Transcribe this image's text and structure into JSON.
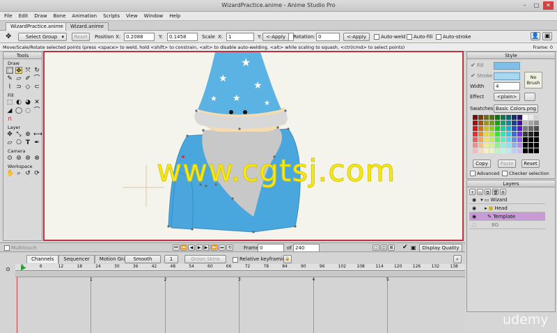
{
  "window": {
    "title": "WizardPractice.anime - Anime Studio Pro"
  },
  "menu": [
    "File",
    "Edit",
    "Draw",
    "Bone",
    "Animation",
    "Scripts",
    "View",
    "Window",
    "Help"
  ],
  "tabs": [
    {
      "label": "WizardPractice.anime",
      "active": true
    },
    {
      "label": "Wizard.anime",
      "active": false
    }
  ],
  "toolbar": {
    "select_group": "Select Group",
    "reset": "Reset",
    "position_label": "Position",
    "x_label": "X:",
    "x_value": "0.2088",
    "y_label": "Y:",
    "y_value": "0.1458",
    "scale_label": "Scale",
    "sx_label": "X:",
    "sx_value": "1",
    "sy_label": "Y:",
    "sy_value": "1",
    "apply1": "<-Apply",
    "rotation_label": "Rotation:",
    "rotation_value": "0",
    "apply2": "<-Apply",
    "auto_weld": "Auto-weld",
    "auto_fill": "Auto-fill",
    "auto_stroke": "Auto-stroke"
  },
  "status": {
    "message": "Move/Scale/Rotate selected points (press <space> to weld, hold <shift> to constrain, <alt> to disable auto-welding, <alt> while scaling to squash, <ctrl/cmd> to select points)",
    "frame": "Frame: 0"
  },
  "tools": {
    "title": "Tools",
    "sections": [
      "Draw",
      "Fill",
      "Layer",
      "Camera",
      "Workspace"
    ]
  },
  "style": {
    "title": "Style",
    "fill_label": "Fill",
    "stroke_label": "Stroke",
    "width_label": "Width",
    "width_value": "4",
    "effect_label": "Effect",
    "effect_value": "<plain>",
    "no_brush": "No Brush",
    "fill_color": "#7fbfe8",
    "stroke_color": "#a8d8f0",
    "swatches_label": "Swatches",
    "swatches_value": "Basic Colors.png",
    "copy": "Copy",
    "paste": "Paste",
    "reset": "Reset",
    "advanced": "Advanced",
    "checker": "Checker selection"
  },
  "layers": {
    "title": "Layers",
    "items": [
      {
        "name": "Wizard",
        "selected": false
      },
      {
        "name": "Head",
        "selected": false
      },
      {
        "name": "Template",
        "selected": true
      },
      {
        "name": "BG",
        "selected": false
      }
    ]
  },
  "playback": {
    "multitouch": "Multitouch",
    "frame_label": "Frame",
    "frame_value": "0",
    "of_label": "of",
    "total_frames": "240",
    "display_quality": "Display Quality"
  },
  "timeline": {
    "tabs": [
      "Channels",
      "Sequencer",
      "Motion Graph"
    ],
    "interp": "Smooth",
    "interp_num": "1",
    "onion": "Onion Skins",
    "relative": "Relative keyframing",
    "ruler": [
      "0",
      "6",
      "12",
      "18",
      "24",
      "30",
      "36",
      "42",
      "48",
      "54",
      "60",
      "66",
      "72",
      "78",
      "84",
      "90",
      "96",
      "102",
      "108",
      "114",
      "120",
      "126",
      "132",
      "138"
    ],
    "seconds": [
      "1",
      "2",
      "3",
      "4",
      "5"
    ]
  },
  "watermark": "www.cgtsj.com",
  "brand": "udemy"
}
